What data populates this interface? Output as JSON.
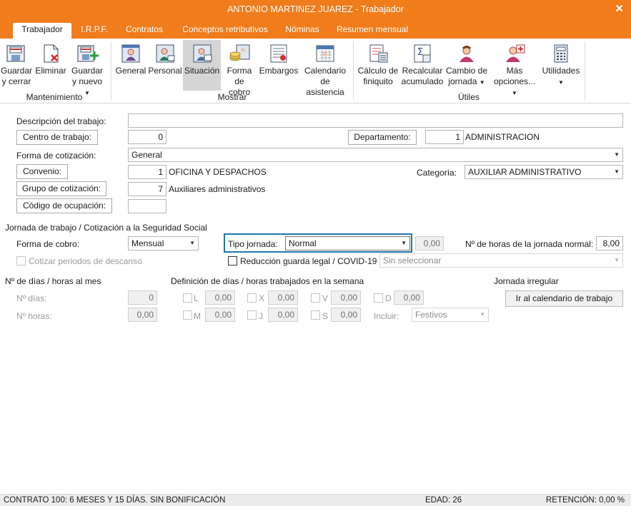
{
  "window": {
    "title": "ANTONIO MARTINEZ JUAREZ - Trabajador",
    "close": "✕"
  },
  "tabs": [
    "Trabajador",
    "I.R.P.F.",
    "Contratos",
    "Conceptos retributivos",
    "Nóminas",
    "Resumen mensual"
  ],
  "ribbon": {
    "mantenimiento": {
      "label": "Mantenimiento",
      "guardar_cerrar": [
        "Guardar",
        "y cerrar"
      ],
      "eliminar": "Eliminar",
      "guardar_nuevo": [
        "Guardar",
        "y nuevo"
      ]
    },
    "mostrar": {
      "label": "Mostrar",
      "general": "General",
      "personal": "Personal",
      "situacion": "Situación",
      "forma_cobro": [
        "Forma",
        "de cobro"
      ],
      "embargos": "Embargos",
      "calendario": [
        "Calendario",
        "de asistencia"
      ]
    },
    "utiles": {
      "label": "Útiles",
      "finiquito": [
        "Cálculo de",
        "finiquito"
      ],
      "recalcular": [
        "Recalcular",
        "acumulado"
      ],
      "cambio_jornada": [
        "Cambio de",
        "jornada"
      ],
      "mas_opciones": [
        "Más",
        "opciones..."
      ],
      "utilidades": "Utilidades"
    }
  },
  "form": {
    "descripcion_label": "Descripción del trabajo:",
    "descripcion_value": "",
    "centro_btn": "Centro de trabajo:",
    "centro_value": "0",
    "departamento_btn": "Departamento:",
    "departamento_code": "1",
    "departamento_name": "ADMINISTRACION",
    "forma_cotizacion_label": "Forma de cotización:",
    "forma_cotizacion_value": "General",
    "convenio_btn": "Convenio:",
    "convenio_code": "1",
    "convenio_name": "OFICINA Y DESPACHOS",
    "categoria_label": "Categoría:",
    "categoria_value": "AUXILIAR ADMINISTRATIVO",
    "grupo_btn": "Grupo de cotización:",
    "grupo_code": "7",
    "grupo_name": "Auxiliares administrativos",
    "ocupacion_btn": "Código de ocupación:",
    "ocupacion_value": ""
  },
  "jornada": {
    "section_title": "Jornada de trabajo / Cotización a la Seguridad Social",
    "forma_cobro_label": "Forma de cobro:",
    "forma_cobro_value": "Mensual",
    "tipo_jornada_label": "Tipo jornada:",
    "tipo_jornada_value": "Normal",
    "tipo_jornada_num": "0,00",
    "horas_normal_label": "Nº de horas de la jornada normal:",
    "horas_normal_value": "8,00",
    "cotizar_label": "Cotizar periodos de descanso",
    "reduccion_label": "Reducción guarda legal / COVID-19",
    "reduccion_select": "Sin seleccionar"
  },
  "dias": {
    "mes_title": "Nº de días / horas al mes",
    "dias_label": "Nº días:",
    "dias_value": "0",
    "horas_label": "Nº horas:",
    "horas_value": "0,00",
    "semana_title": "Definición de días / horas trabajados en la semana",
    "L": "L",
    "M": "M",
    "X": "X",
    "J": "J",
    "V": "V",
    "S": "S",
    "D": "D",
    "zero": "0,00",
    "incluir_label": "Incluir:",
    "incluir_value": "Festivos",
    "irregular_title": "Jornada irregular",
    "calendario_btn": "Ir al calendario de trabajo"
  },
  "status": {
    "contrato": "CONTRATO 100: 6 MESES Y 15 DÍAS.  SIN BONIFICACIÓN",
    "edad": "EDAD: 26",
    "retencion": "RETENCIÓN: 0,00 %"
  }
}
